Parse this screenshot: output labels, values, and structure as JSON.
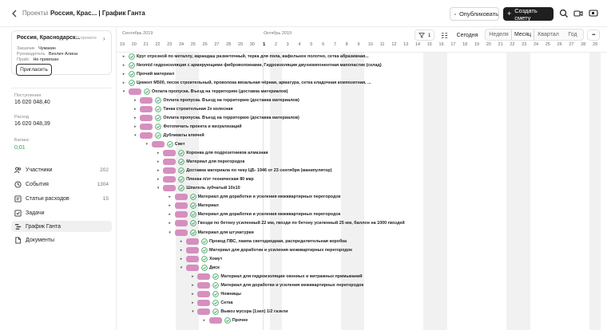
{
  "header": {
    "breadcrumb_projects": "Проекты",
    "breadcrumb_sep": "/",
    "breadcrumb_current": "Россия, Крас... | График Ганта",
    "publish_label": "Опубликовать",
    "create_label": "Создать смету"
  },
  "project": {
    "title": "Россия, Краснодарск...",
    "more_label": "О проекте",
    "rows": [
      {
        "k": "Заказчик",
        "v": "Чумакин"
      },
      {
        "k": "Руководитель",
        "v": "Вехлич Алина"
      },
      {
        "k": "Прайс",
        "v": "Не привязан"
      }
    ],
    "invite_label": "Пригласить"
  },
  "finance": {
    "income_label": "Поступления",
    "income_value": "16 020 048,40",
    "expense_label": "Расход",
    "expense_value": "16 020 048,39",
    "balance_label": "Баланс",
    "balance_value": "0,01"
  },
  "nav": [
    {
      "label": "Участники",
      "count": "202",
      "icon": "users-icon"
    },
    {
      "label": "События",
      "count": "1304",
      "icon": "events-icon"
    },
    {
      "label": "Статьи расходов",
      "count": "15",
      "icon": "expenses-icon"
    },
    {
      "label": "Задачи",
      "count": "",
      "icon": "tasks-icon"
    },
    {
      "label": "График Ганта",
      "count": "",
      "icon": "gantt-icon"
    },
    {
      "label": "Документы",
      "count": "",
      "icon": "documents-icon"
    }
  ],
  "gantt": {
    "month1": "Сентябрь 2019",
    "month2": "Октябрь 2019",
    "filter_count": "1",
    "today_label": "Сегодня",
    "scales": [
      "Неделя",
      "Месяц",
      "Квартал",
      "Год"
    ],
    "active_scale": "Месяц",
    "more": "•••",
    "days": [
      "19",
      "20",
      "21",
      "22",
      "23",
      "24",
      "25",
      "26",
      "27",
      "28",
      "29",
      "30",
      "1",
      "2",
      "3",
      "4",
      "5",
      "6",
      "7",
      "8",
      "9",
      "10",
      "11",
      "12",
      "13",
      "14",
      "15",
      "16",
      "17",
      "18",
      "19",
      "20",
      "21",
      "22",
      "23",
      "24",
      "25",
      "26",
      "27",
      "28",
      "29"
    ],
    "rows": [
      {
        "level": 0,
        "tri": "▸",
        "bar": false,
        "text": "Круг отрезной по металлу, карандаш разметочный, терка для пола, вафельное полотно, сетка абразивная..."
      },
      {
        "level": 0,
        "tri": "▸",
        "bar": false,
        "text": "Neomid гидроизоляция с армирующими фиброволокнами, Гидроизоляция двухкомпонентная мапопастик (склад)"
      },
      {
        "level": 0,
        "tri": "▸",
        "bar": false,
        "text": "Прочий материал"
      },
      {
        "level": 0,
        "tri": "▸",
        "bar": false,
        "text": "Цемент М500, песок строительный, проволока вязальная чёрная, арматура, сетка кладочная композитная, ..."
      },
      {
        "level": 0,
        "tri": "▾",
        "bar": true,
        "text": "Оплата пропуска. Въезд на территорию (доставка материалов)"
      },
      {
        "level": 1,
        "tri": "▸",
        "bar": true,
        "text": "Оплата пропуска. Въезд на территорию (доставка материалов)"
      },
      {
        "level": 1,
        "tri": "▸",
        "bar": true,
        "text": "Тачка строительная 2х колесная"
      },
      {
        "level": 1,
        "tri": "▸",
        "bar": true,
        "text": "Оплата пропуска. Въезд на территорию (доставка материалов)"
      },
      {
        "level": 1,
        "tri": "▸",
        "bar": true,
        "text": "Фотопечать проекта и визуализаций"
      },
      {
        "level": 1,
        "tri": "▾",
        "bar": true,
        "text": "Дубликаты ключей"
      },
      {
        "level": 2,
        "tri": "▾",
        "bar": true,
        "text": "Свет"
      },
      {
        "level": 3,
        "tri": "▸",
        "bar": true,
        "text": "Коронка для подрозетников алмазная"
      },
      {
        "level": 3,
        "tri": "▸",
        "bar": true,
        "text": "Материал для перегородок"
      },
      {
        "level": 3,
        "tri": "▸",
        "bar": true,
        "text": "Доставка материала по чеку ЦБ- 1946 от 23 сентября (манипулятор)"
      },
      {
        "level": 3,
        "tri": "▸",
        "bar": true,
        "text": "Пленка п/эт техническая 80 мкр"
      },
      {
        "level": 3,
        "tri": "▾",
        "bar": true,
        "text": "Шпатель зубчатый 10х10"
      },
      {
        "level": 4,
        "tri": "▸",
        "bar": true,
        "text": "Материал для доработки и усиления межквартирных перегородок"
      },
      {
        "level": 4,
        "tri": "▸",
        "bar": true,
        "text": "Материал"
      },
      {
        "level": 4,
        "tri": "▸",
        "bar": true,
        "text": "Материал для доработки и усиления межквартирных перегородок"
      },
      {
        "level": 4,
        "tri": "▸",
        "bar": true,
        "text": "Гвозди по бетону усиленный 22 мм, гвозди по бетону усиленный 25 мм, баллон на 1000 гвоздей"
      },
      {
        "level": 4,
        "tri": "▾",
        "bar": true,
        "text": "Материал для штукатурки"
      },
      {
        "level": 5,
        "tri": "▸",
        "bar": true,
        "text": "Провод ПВС, лампа светодиодная, распределительная коробка"
      },
      {
        "level": 5,
        "tri": "▸",
        "bar": true,
        "text": "Материал для доработки и усиления межквартирных перегородок"
      },
      {
        "level": 5,
        "tri": "▸",
        "bar": true,
        "text": "Хомут"
      },
      {
        "level": 5,
        "tri": "▾",
        "bar": true,
        "text": "Диск"
      },
      {
        "level": 6,
        "tri": "▸",
        "bar": true,
        "text": "Материал для гидроизоляции оконных и витражных примыканий"
      },
      {
        "level": 6,
        "tri": "▸",
        "bar": true,
        "text": "Материал для доработки и усиления межквартирных перегородок"
      },
      {
        "level": 6,
        "tri": "▸",
        "bar": true,
        "text": "Ножницы"
      },
      {
        "level": 6,
        "tri": "▸",
        "bar": true,
        "text": "Сетка"
      },
      {
        "level": 6,
        "tri": "▾",
        "bar": true,
        "text": "Вывоз мусора (1зил) 1/2 газели"
      },
      {
        "level": 7,
        "tri": "▸",
        "bar": true,
        "text": "Прочее"
      }
    ]
  },
  "colors": {
    "bar": "#d68fbf",
    "check": "#2e9c52",
    "balance": "#2e9c52"
  }
}
